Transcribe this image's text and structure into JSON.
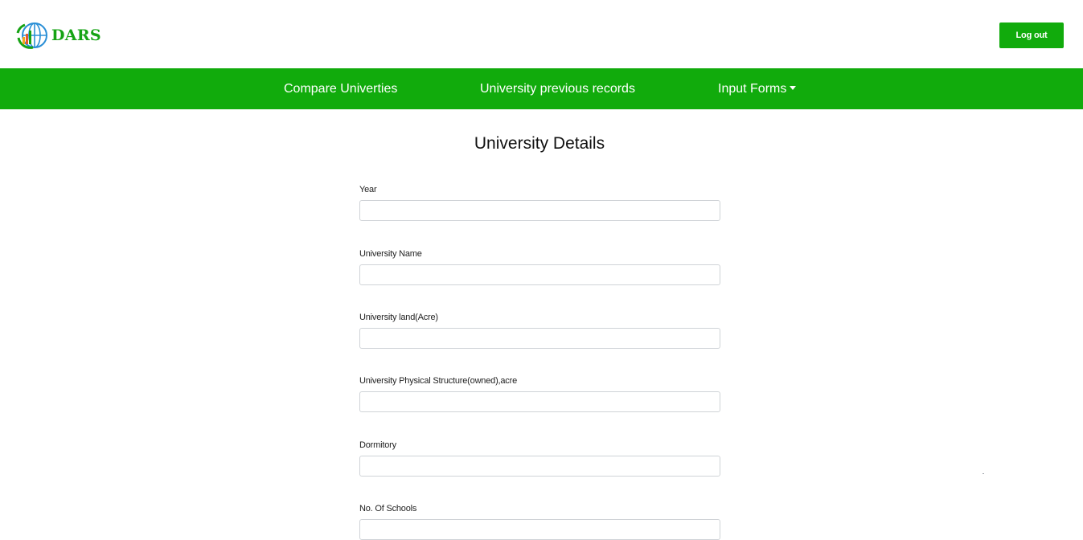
{
  "header": {
    "brand": "DARS",
    "logo_icon": "globe-chart-logo-icon",
    "logout_label": "Log out"
  },
  "nav": {
    "items": [
      {
        "label": "Compare Univerties"
      },
      {
        "label": "University previous records"
      },
      {
        "label": "Input Forms"
      }
    ]
  },
  "page": {
    "title": "University Details"
  },
  "form": {
    "fields": [
      {
        "label": "Year",
        "value": ""
      },
      {
        "label": "University Name",
        "value": ""
      },
      {
        "label": "University land(Acre)",
        "value": ""
      },
      {
        "label": "University Physical Structure(owned),acre",
        "value": ""
      },
      {
        "label": "Dormitory",
        "value": ""
      },
      {
        "label": "No. Of Schools",
        "value": ""
      }
    ]
  },
  "colors": {
    "accent": "#11ab0c",
    "brand_text": "#16a314",
    "logo_blue": "#2a8fd6"
  }
}
